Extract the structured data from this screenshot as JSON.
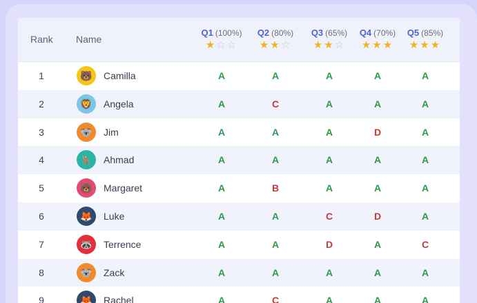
{
  "header": {
    "rank_label": "Rank",
    "name_label": "Name",
    "questions": [
      {
        "label": "Q1",
        "pct": "(100%)",
        "stars": 1
      },
      {
        "label": "Q2",
        "pct": "(80%)",
        "stars": 2
      },
      {
        "label": "Q3",
        "pct": "(65%)",
        "stars": 2
      },
      {
        "label": "Q4",
        "pct": "(70%)",
        "stars": 3
      },
      {
        "label": "Q5",
        "pct": "(85%)",
        "stars": 3
      }
    ]
  },
  "colors": {
    "star_on": "#f1b21c",
    "star_off": "#c5c9d8",
    "pass": "#2e9a4a",
    "fail": "#c23a3a"
  },
  "rows": [
    {
      "rank": "1",
      "name": "Camilla",
      "avatar_icon": "bear-icon",
      "avatar_color": "#f5c518",
      "grades": [
        "A",
        "A",
        "A",
        "A",
        "A"
      ]
    },
    {
      "rank": "2",
      "name": "Angela",
      "avatar_icon": "lion-icon",
      "avatar_color": "#7cc6e8",
      "grades": [
        "A",
        "C",
        "A",
        "A",
        "A"
      ]
    },
    {
      "rank": "3",
      "name": "Jim",
      "avatar_icon": "koala-icon",
      "avatar_color": "#f08a2c",
      "grades": [
        "A",
        "A",
        "A",
        "D",
        "A"
      ]
    },
    {
      "rank": "4",
      "name": "Ahmad",
      "avatar_icon": "deer-icon",
      "avatar_color": "#2bb3a6",
      "grades": [
        "A",
        "A",
        "A",
        "A",
        "A"
      ]
    },
    {
      "rank": "5",
      "name": "Margaret",
      "avatar_icon": "bear-icon",
      "avatar_color": "#e34a78",
      "grades": [
        "A",
        "B",
        "A",
        "A",
        "A"
      ]
    },
    {
      "rank": "6",
      "name": "Luke",
      "avatar_icon": "fox-icon",
      "avatar_color": "#2f4a6e",
      "grades": [
        "A",
        "A",
        "C",
        "D",
        "A"
      ]
    },
    {
      "rank": "7",
      "name": "Terrence",
      "avatar_icon": "raccoon-icon",
      "avatar_color": "#e0303a",
      "grades": [
        "A",
        "A",
        "D",
        "A",
        "C"
      ]
    },
    {
      "rank": "8",
      "name": "Zack",
      "avatar_icon": "koala-icon",
      "avatar_color": "#f08a2c",
      "grades": [
        "A",
        "A",
        "A",
        "A",
        "A"
      ]
    },
    {
      "rank": "9",
      "name": "Rachel",
      "avatar_icon": "fox-icon",
      "avatar_color": "#2f4a6e",
      "grades": [
        "A",
        "C",
        "A",
        "A",
        "A"
      ]
    }
  ]
}
